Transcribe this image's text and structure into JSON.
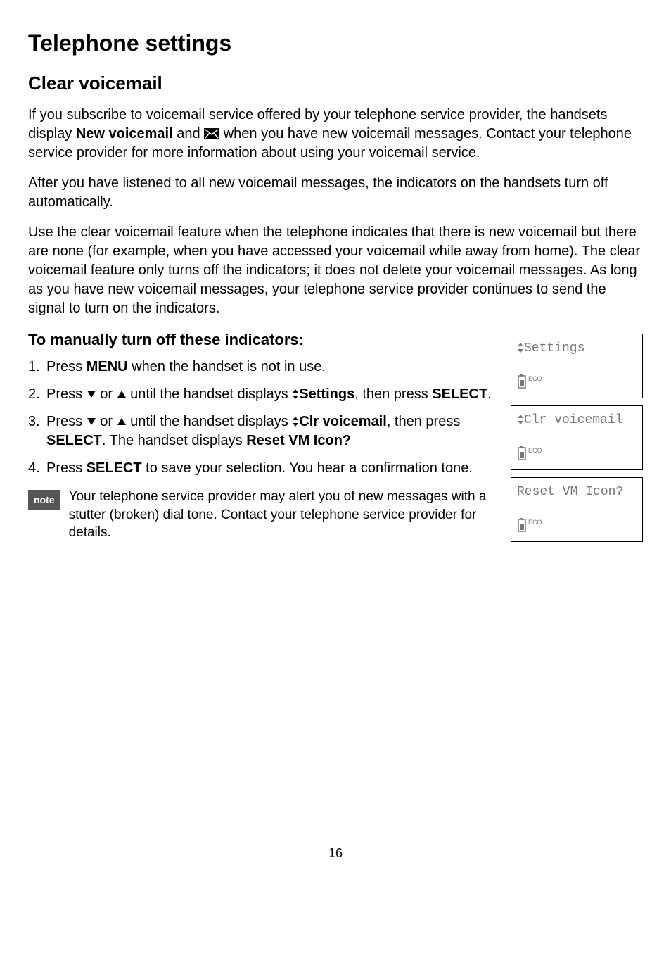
{
  "pageTitle": "Telephone settings",
  "sectionTitle": "Clear voicemail",
  "para1a": "If you subscribe to voicemail service offered by your telephone service provider, the handsets display ",
  "para1b": "New voicemail",
  "para1c": " and ",
  "para1d": " when you have new voicemail messages. Contact your telephone service provider for more information about using your voicemail service.",
  "para2": "After you have listened to all new voicemail messages, the indicators on the handsets turn off automatically.",
  "para3": "Use the clear voicemail feature when the telephone indicates that there is new voicemail but there are none (for example, when you have accessed your voicemail while away from home). The clear voicemail feature only turns off the indicators; it does not delete your voicemail messages. As long as you have new voicemail messages, your telephone service provider continues to send the signal to turn on the indicators.",
  "stepsTitle": "To manually turn off these indicators:",
  "steps": {
    "s1a": "Press ",
    "s1b": "MENU",
    "s1c": " when the handset is not in use.",
    "s2a": "Press ",
    "s2b": " or ",
    "s2c": " until the handset displays ",
    "s2d": "Settings",
    "s2e": ", then press ",
    "s2f": "SELECT",
    "s2g": ".",
    "s3a": "Press ",
    "s3b": " or ",
    "s3c": " until the handset displays ",
    "s3d": "Clr voicemail",
    "s3e": ", then press ",
    "s3f": "SELECT",
    "s3g": ". The handset displays ",
    "s3h": "Reset VM Icon?",
    "s4a": "Press ",
    "s4b": "SELECT",
    "s4c": " to save your selection. You hear a confirmation tone."
  },
  "noteLabel": "note",
  "noteText": "Your telephone service provider may alert you of new messages with a stutter (broken) dial tone. Contact your telephone service provider for details.",
  "screens": {
    "s1": "Settings",
    "s2": "Clr voicemail",
    "s3": "Reset VM Icon?",
    "ecoLabel": "ECO"
  },
  "pageNumber": "16"
}
